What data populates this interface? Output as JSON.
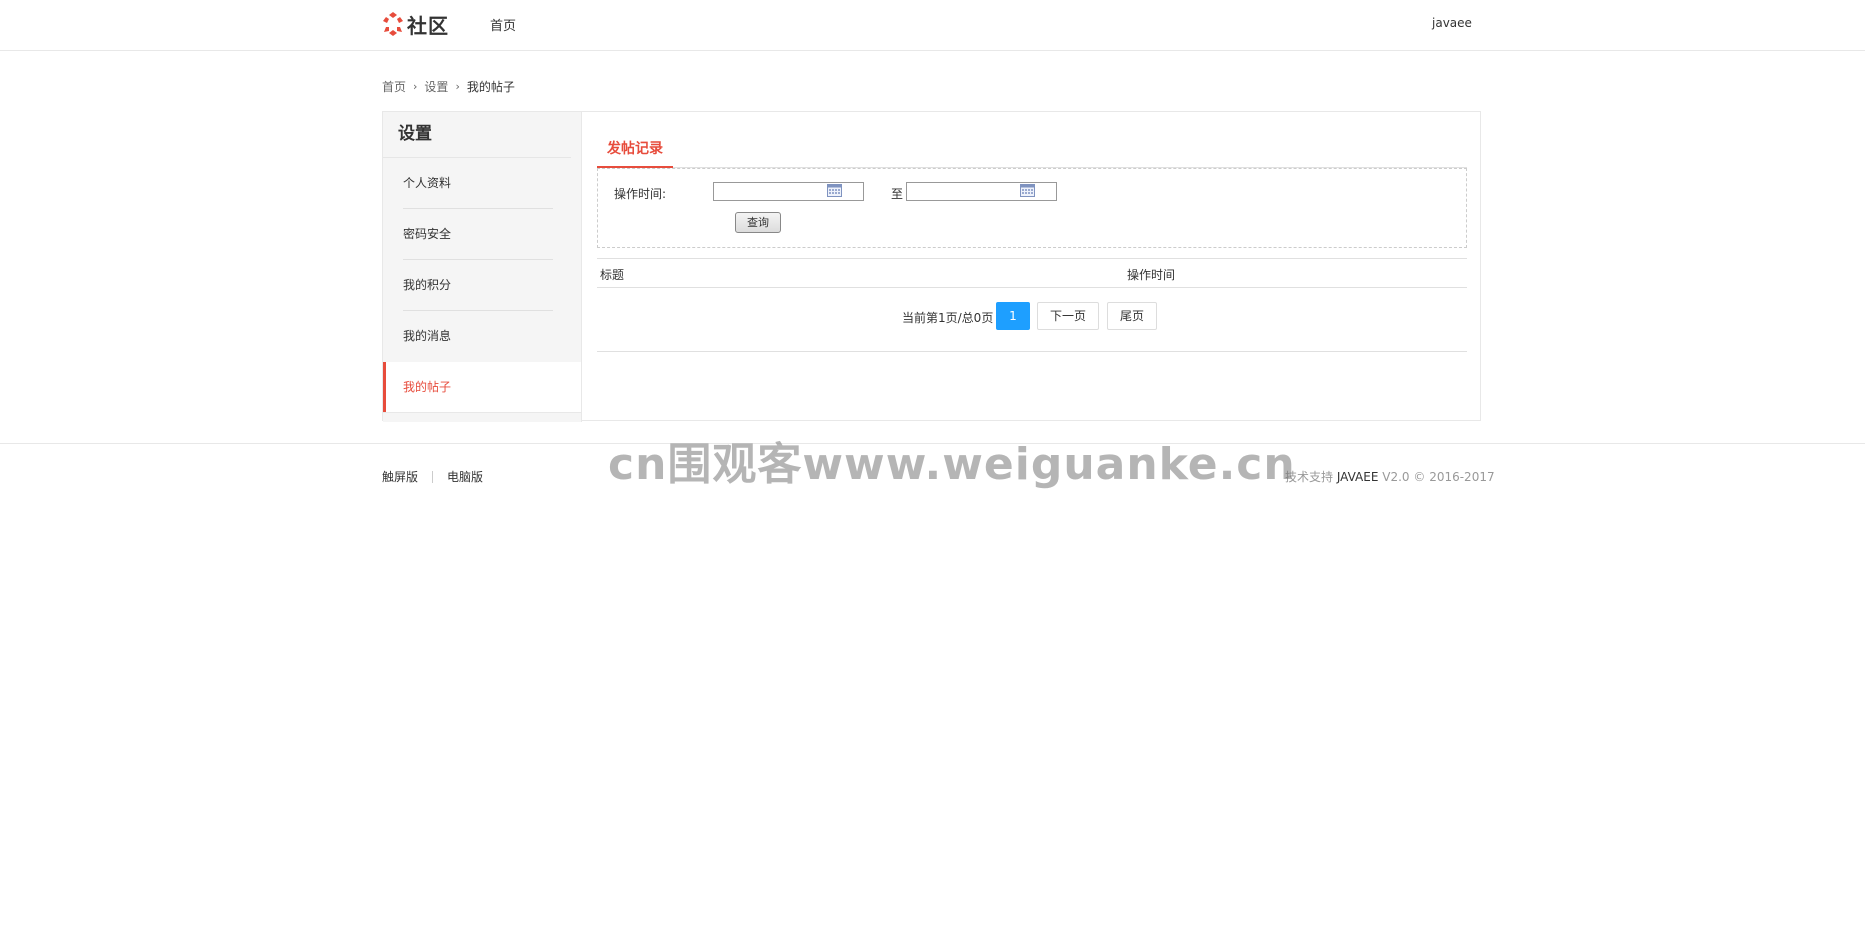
{
  "header": {
    "logo_text": "社区",
    "nav_home": "首页",
    "user_name": "javaee",
    "brand_color": "#e74c3c"
  },
  "breadcrumb": {
    "items": [
      "首页",
      "设置",
      "我的帖子"
    ],
    "separator": "›"
  },
  "sidebar": {
    "title": "设置",
    "items": [
      {
        "label": "个人资料",
        "active": false
      },
      {
        "label": "密码安全",
        "active": false
      },
      {
        "label": "我的积分",
        "active": false
      },
      {
        "label": "我的消息",
        "active": false
      },
      {
        "label": "我的帖子",
        "active": true
      }
    ]
  },
  "main": {
    "tab_label": "发帖记录",
    "search": {
      "time_label": "操作时间:",
      "start_value": "",
      "to_label": "至",
      "end_value": "",
      "query_button": "查询"
    },
    "table": {
      "columns": [
        "标题",
        "操作时间"
      ],
      "rows": []
    },
    "pager": {
      "info": "当前第1页/总0页",
      "current_page": "1",
      "next_label": "下一页",
      "last_label": "尾页",
      "active_color": "#1e9fff"
    }
  },
  "footer": {
    "links": [
      "触屏版",
      "电脑版"
    ],
    "support_prefix": "技术支持",
    "support_brand": "JAVAEE",
    "version": "V2.0 © 2016-2017"
  },
  "watermark": "cn围观客www.weiguanke.cn"
}
